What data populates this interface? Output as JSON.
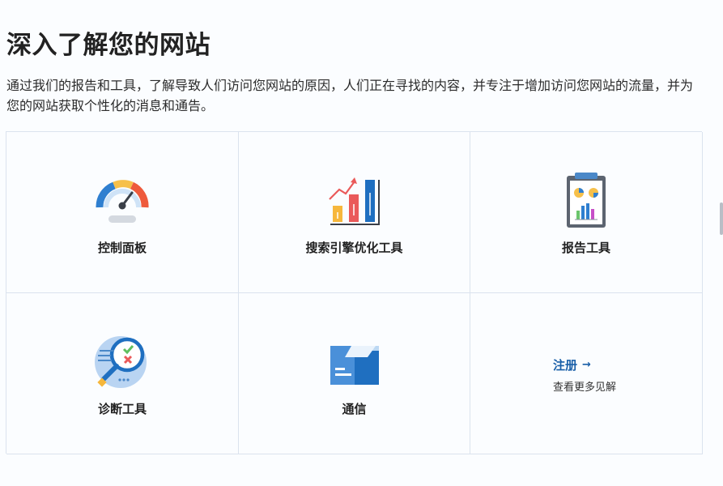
{
  "page": {
    "title": "深入了解您的网站",
    "description": "通过我们的报告和工具，了解导致人们访问您网站的原因，人们正在寻找的内容，并专注于增加访问您网站的流量，并为您的网站获取个性化的消息和通告。"
  },
  "tools": [
    {
      "label": "控制面板",
      "icon": "speedometer-icon"
    },
    {
      "label": "搜索引擎优化工具",
      "icon": "bar-chart-growth-icon"
    },
    {
      "label": "报告工具",
      "icon": "clipboard-report-icon"
    },
    {
      "label": "诊断工具",
      "icon": "magnifier-diagnostic-icon"
    },
    {
      "label": "通信",
      "icon": "open-box-icon"
    }
  ],
  "signup": {
    "label": "注册",
    "arrow": "→",
    "subtext": "查看更多见解"
  },
  "colors": {
    "link": "#1a5fa8",
    "border": "#dbe3ee",
    "background": "#fbfdff"
  }
}
